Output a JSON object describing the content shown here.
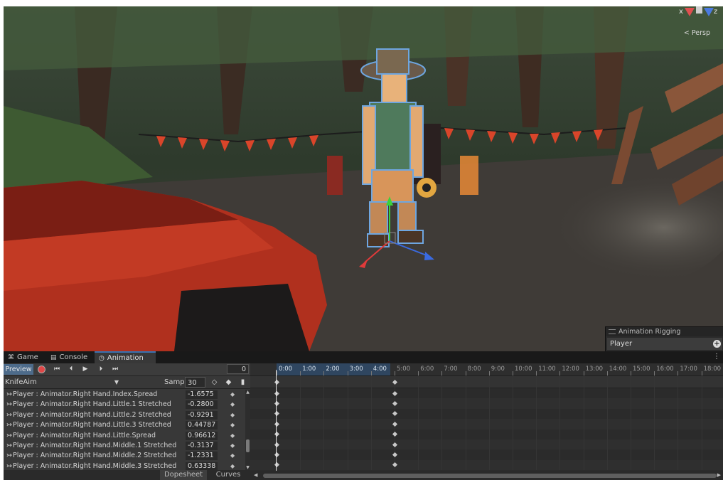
{
  "scene": {
    "persp_label": "< Persp",
    "gizmo_x": "x",
    "gizmo_z": "z"
  },
  "rigging_panel": {
    "title": "Animation Rigging",
    "value": "Player",
    "add_icon": "plus-circle-icon"
  },
  "tabs": [
    {
      "label": "Game",
      "icon": "gamepad-icon"
    },
    {
      "label": "Console",
      "icon": "console-icon"
    },
    {
      "label": "Animation",
      "icon": "clock-icon"
    }
  ],
  "tab_menu_icon": "lock-icon",
  "toolbar": {
    "preview_label": "Preview",
    "frame_value": "0",
    "buttons": [
      "first-key-icon",
      "prev-key-icon",
      "play-icon",
      "next-key-icon",
      "last-key-icon"
    ]
  },
  "clip": {
    "name": "KnifeAim",
    "samples_label": "Samples",
    "samples_value": "30"
  },
  "properties": [
    {
      "name": "Player : Animator.Right Hand.Index.Spread",
      "value": "-1.6575"
    },
    {
      "name": "Player : Animator.Right Hand.Little.1 Stretched",
      "value": "-0.2800"
    },
    {
      "name": "Player : Animator.Right Hand.Little.2 Stretched",
      "value": "-0.9291"
    },
    {
      "name": "Player : Animator.Right Hand.Little.3 Stretched",
      "value": "0.44787"
    },
    {
      "name": "Player : Animator.Right Hand.Little.Spread",
      "value": "0.96612"
    },
    {
      "name": "Player : Animator.Right Hand.Middle.1 Stretched",
      "value": "-0.3137"
    },
    {
      "name": "Player : Animator.Right Hand.Middle.2 Stretched",
      "value": "-1.2331"
    },
    {
      "name": "Player : Animator.Right Hand.Middle.3 Stretched",
      "value": "0.63338"
    }
  ],
  "bottom_tabs": [
    "Dopesheet",
    "Curves"
  ],
  "timeline": {
    "ticks": [
      "0:00",
      "1:00",
      "2:00",
      "3:00",
      "4:00",
      "5:00",
      "6:00",
      "7:00",
      "8:00",
      "9:00",
      "10:00",
      "11:00",
      "12:00",
      "13:00",
      "14:00",
      "15:00",
      "16:00",
      "17:00",
      "18:00"
    ],
    "highlighted_ticks": 5,
    "keyframe_times": [
      "0:00",
      "5:00"
    ]
  }
}
